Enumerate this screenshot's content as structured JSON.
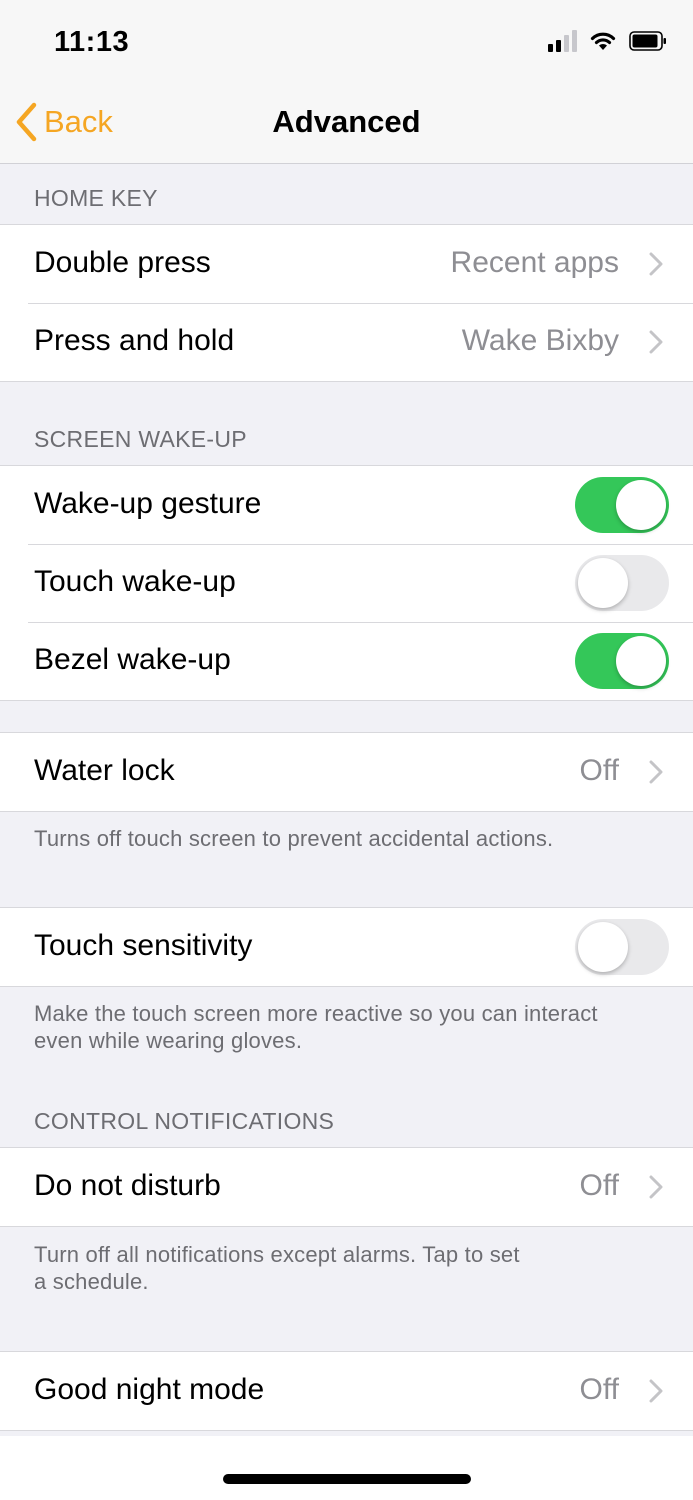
{
  "status_bar": {
    "time": "11:13"
  },
  "nav": {
    "back_label": "Back",
    "title": "Advanced"
  },
  "home_key": {
    "header": "HOME KEY",
    "rows": [
      {
        "label": "Double press",
        "value": "Recent apps"
      },
      {
        "label": "Press and hold",
        "value": "Wake Bixby"
      }
    ]
  },
  "screen_wakeup": {
    "header": "SCREEN WAKE-UP",
    "rows": [
      {
        "label": "Wake-up gesture",
        "enabled": true
      },
      {
        "label": "Touch wake-up",
        "enabled": false
      },
      {
        "label": "Bezel wake-up",
        "enabled": true
      }
    ]
  },
  "water_lock": {
    "label": "Water lock",
    "value": "Off",
    "note": "Turns off touch screen to prevent accidental actions."
  },
  "touch_sensitivity": {
    "label": "Touch sensitivity",
    "enabled": false,
    "note_line1": "Make the touch screen more reactive so you can interact",
    "note_line2": "even while wearing gloves."
  },
  "control_notifications": {
    "header": "CONTROL NOTIFICATIONS",
    "dnd_label": "Do not disturb",
    "dnd_value": "Off",
    "note_line1": "Turn off all notifications except alarms. Tap to set",
    "note_line2": "a schedule."
  },
  "good_night": {
    "label": "Good night mode",
    "value": "Off"
  },
  "colors": {
    "accent": "#f5a623",
    "toggle_on": "#34c759",
    "toggle_off": "#e9e9eb"
  }
}
